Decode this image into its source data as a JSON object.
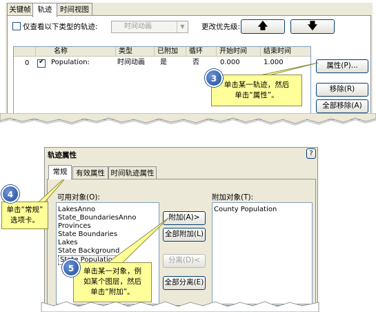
{
  "top": {
    "tabs": [
      "关键帧",
      "轨迹",
      "时间视图"
    ],
    "filter_label": "仅查看以下类型的轨迹:",
    "filter_combo": "时间动画",
    "priority_label": "更改优先级:",
    "up_arrow": "🡅",
    "down_arrow": "🡇",
    "columns": [
      "名称",
      "类型",
      "已附加",
      "循环",
      "开始时间",
      "结束时间"
    ],
    "row": {
      "index": "0",
      "name": "Population:",
      "type": "时间动画",
      "attached": "是",
      "loop": "否",
      "start": "0.000",
      "end": "1.000"
    },
    "properties_button": "属性(P)...",
    "remove_button": "移除(R)",
    "remove_all_button": "全部移除(A)"
  },
  "callout3": {
    "number": "3",
    "line1": "单击某一轨迹，然后",
    "line2": "单击“属性”。"
  },
  "dialog": {
    "title": "轨迹属性",
    "help": "?",
    "tabs": [
      "常规",
      "有效属性",
      "时间轨迹属性"
    ],
    "available_label": "可用对象(O):",
    "attached_label": "附加对象(T):",
    "available_items": [
      "LakesAnno",
      "State_BoundariesAnno",
      "Provinces",
      "State Boundaries",
      "Lakes",
      "State Background",
      "State Population"
    ],
    "attached_items": [
      "County Population"
    ],
    "attach_button": "附加(A)>",
    "attach_all_button": "全部附加(L)",
    "detach_button": "分离(D)<",
    "detach_all_button": "全部分离(E)"
  },
  "callout4": {
    "number": "4",
    "line1": "单击“常规”",
    "line2": "选项卡。"
  },
  "callout5": {
    "number": "5",
    "line1": "单击某一对象，例",
    "line2": "如某个图层，然后",
    "line3": "单击“附加”。"
  }
}
